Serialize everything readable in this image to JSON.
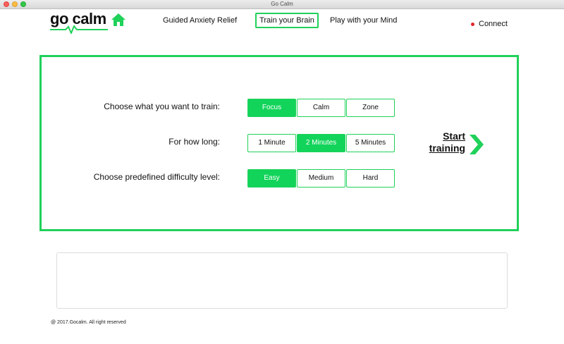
{
  "window": {
    "title": "Go Calm"
  },
  "header": {
    "logo_text": "go calm",
    "nav": {
      "guided": "Guided Anxiety Relief",
      "train": "Train your Brain",
      "play": "Play with your Mind"
    },
    "connect_label": "Connect"
  },
  "training": {
    "what": {
      "label": "Choose what you want to train:",
      "options": [
        "Focus",
        "Calm",
        "Zone"
      ],
      "selected": "Focus"
    },
    "duration": {
      "label": "For how long:",
      "options": [
        "1 Minute",
        "2 Minutes",
        "5 Minutes"
      ],
      "selected": "2 Minutes"
    },
    "difficulty": {
      "label": "Choose predefined difficulty level:",
      "options": [
        "Easy",
        "Medium",
        "Hard"
      ],
      "selected": "Easy"
    },
    "start_line1": "Start",
    "start_line2": "training"
  },
  "footer": {
    "text": "@ 2017.Gocalm. All right reserved"
  },
  "colors": {
    "accent": "#20d15a",
    "selected_fill": "#12d45a",
    "connect_dot": "#e0252b"
  }
}
